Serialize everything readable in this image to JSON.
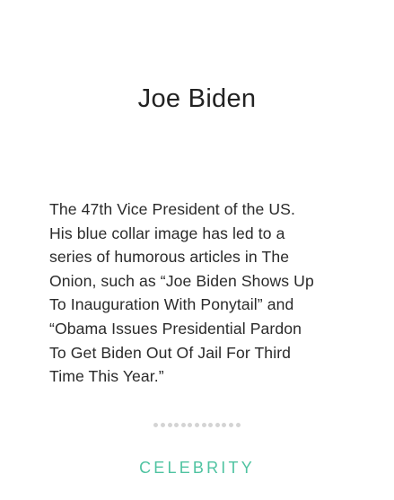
{
  "card": {
    "title": "Joe Biden",
    "description_lines": [
      "The 47th Vice President of the US.",
      "His blue collar image has led to a",
      "series of humorous articles in The",
      "Onion, such as “Joe Biden Shows Up",
      "To Inauguration With Ponytail” and",
      "“Obama Issues Presidential Pardon",
      "To Get Biden Out Of Jail For Third",
      "Time This Year.”"
    ],
    "category": "CELEBRITY"
  },
  "colors": {
    "accent": "#4fc3a1",
    "divider_dots": "#d4d4d4",
    "text": "#222222"
  },
  "divider": {
    "dot_count": 13
  }
}
